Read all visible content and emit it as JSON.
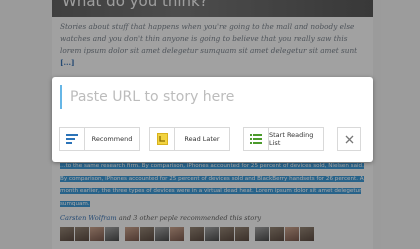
{
  "article": {
    "title": "What do you think?",
    "excerpt": "Stories about stuff that happens when you're going to the mall and nobody else watches and you don't thin anyone is going to believe that you really saw this lorem ipsum dolor sit amet delegetur sumquam sit amet delegetur sit amet sunt",
    "read_more": "[...]"
  },
  "modal": {
    "url_placeholder": "Paste URL to story here",
    "buttons": [
      {
        "label": "Recommend",
        "icon": "list-lines-icon",
        "color": "#2b73b8"
      },
      {
        "label": "Read Later",
        "icon": "read-later-bookmark-icon",
        "color": "#e8c32c"
      },
      {
        "label": "Start Reading List",
        "icon": "bulleted-list-icon",
        "color": "#4c9b2c"
      }
    ],
    "close_icon": "close-icon"
  },
  "selection": {
    "text": "…to the same research firm. By comparison, iPhones accounted for 25 percent of devices sold, Nielsen said. By comparison, iPhones accounted for 25 percent of devices sold and BlackBerry handsets for 26 percent. A month earlier, the three types of devices were in a virtual dead heat. Lorem ipsum dolor sit amet delegetur sumquam."
  },
  "recommendation": {
    "names": "Carsten Wolfram",
    "suffix": " and 3 other peple recommended this story"
  },
  "colors": {
    "overlay": "rgba(30,30,30,0.38)",
    "input_accent": "#66b6e6",
    "highlight": "#2f8fce",
    "link": "#2b66a8"
  }
}
